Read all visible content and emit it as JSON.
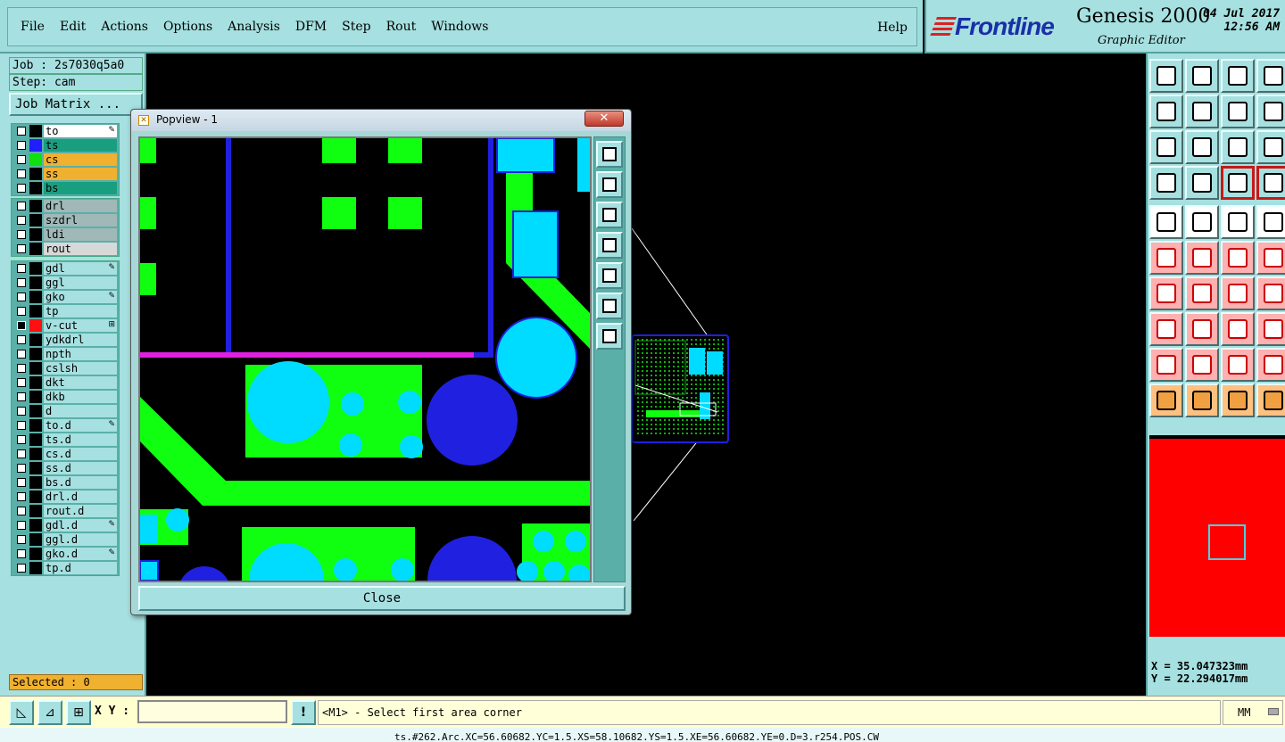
{
  "menu": {
    "items": [
      "File",
      "Edit",
      "Actions",
      "Options",
      "Analysis",
      "DFM",
      "Step",
      "Rout",
      "Windows"
    ],
    "help": "Help"
  },
  "brand": {
    "logo": "Frontline",
    "product": "Genesis 2000",
    "subtitle": "Graphic Editor",
    "date": "04 Jul 2017",
    "time": "12:56 AM"
  },
  "job": {
    "job_label": "Job : 2s7030q5a0",
    "step_label": "Step: cam",
    "matrix_button": "Job Matrix ..."
  },
  "layers": {
    "group1": [
      {
        "name": "to",
        "color": "#ffffff",
        "swatch": "#000000",
        "mark": "✎"
      },
      {
        "name": "ts",
        "color": "#1a9e80",
        "swatch": "#2020ff",
        "mark": ""
      },
      {
        "name": "cs",
        "color": "#f0b030",
        "swatch": "#10e010",
        "mark": ""
      },
      {
        "name": "ss",
        "color": "#f0b030",
        "swatch": "#000000",
        "mark": ""
      },
      {
        "name": "bs",
        "color": "#1a9e80",
        "swatch": "#000000",
        "mark": ""
      }
    ],
    "group2": [
      {
        "name": "drl",
        "color": "#a0b8b8",
        "swatch": "#000000",
        "mark": ""
      },
      {
        "name": "szdrl",
        "color": "#a0b8b8",
        "swatch": "#000000",
        "mark": ""
      },
      {
        "name": "ldi",
        "color": "#a0b8b8",
        "swatch": "#000000",
        "mark": ""
      },
      {
        "name": "rout",
        "color": "#d8d8d8",
        "swatch": "#000000",
        "mark": ""
      }
    ],
    "group3": [
      {
        "name": "gdl",
        "color": "#a6e0e0",
        "swatch": "#000000",
        "mark": "✎"
      },
      {
        "name": "ggl",
        "color": "#a6e0e0",
        "swatch": "#000000",
        "mark": ""
      },
      {
        "name": "gko",
        "color": "#a6e0e0",
        "swatch": "#000000",
        "mark": "✎"
      },
      {
        "name": "tp",
        "color": "#a6e0e0",
        "swatch": "#000000",
        "mark": ""
      },
      {
        "name": "v-cut",
        "color": "#a6e0e0",
        "swatch": "#ff1010",
        "mark": "⊞"
      },
      {
        "name": "ydkdrl",
        "color": "#a6e0e0",
        "swatch": "#000000",
        "mark": ""
      },
      {
        "name": "npth",
        "color": "#a6e0e0",
        "swatch": "#000000",
        "mark": ""
      },
      {
        "name": "cslsh",
        "color": "#a6e0e0",
        "swatch": "#000000",
        "mark": ""
      },
      {
        "name": "dkt",
        "color": "#a6e0e0",
        "swatch": "#000000",
        "mark": ""
      },
      {
        "name": "dkb",
        "color": "#a6e0e0",
        "swatch": "#000000",
        "mark": ""
      },
      {
        "name": "d",
        "color": "#a6e0e0",
        "swatch": "#000000",
        "mark": ""
      },
      {
        "name": "to.d",
        "color": "#a6e0e0",
        "swatch": "#000000",
        "mark": "✎"
      },
      {
        "name": "ts.d",
        "color": "#a6e0e0",
        "swatch": "#000000",
        "mark": ""
      },
      {
        "name": "cs.d",
        "color": "#a6e0e0",
        "swatch": "#000000",
        "mark": ""
      },
      {
        "name": "ss.d",
        "color": "#a6e0e0",
        "swatch": "#000000",
        "mark": ""
      },
      {
        "name": "bs.d",
        "color": "#a6e0e0",
        "swatch": "#000000",
        "mark": ""
      },
      {
        "name": "drl.d",
        "color": "#a6e0e0",
        "swatch": "#000000",
        "mark": ""
      },
      {
        "name": "rout.d",
        "color": "#a6e0e0",
        "swatch": "#000000",
        "mark": ""
      },
      {
        "name": "gdl.d",
        "color": "#a6e0e0",
        "swatch": "#000000",
        "mark": "✎"
      },
      {
        "name": "ggl.d",
        "color": "#a6e0e0",
        "swatch": "#000000",
        "mark": ""
      },
      {
        "name": "gko.d",
        "color": "#a6e0e0",
        "swatch": "#000000",
        "mark": "✎"
      },
      {
        "name": "tp.d",
        "color": "#a6e0e0",
        "swatch": "#000000",
        "mark": ""
      }
    ]
  },
  "selected": "Selected : 0",
  "popview": {
    "title": "Popview - 1",
    "close_x": "✕",
    "close_button": "Close"
  },
  "bottom": {
    "xy_label": "X Y :",
    "xy_value": "",
    "message": "<M1> - Select first area corner",
    "units": "MM",
    "status": "ts.#262.Arc.XC=56.60682.YC=1.5.XS=58.10682.YS=1.5.XE=56.60682.YE=0.D=3.r254.POS.CW"
  },
  "coords": {
    "x": "X = 35.047323mm",
    "y": "Y = 22.294017mm"
  },
  "colors": {
    "copper": "#00ff00",
    "pad": "#00dcff",
    "via": "#2020e0",
    "trace_magenta": "#e020e0",
    "minimap": "#ff0000"
  }
}
